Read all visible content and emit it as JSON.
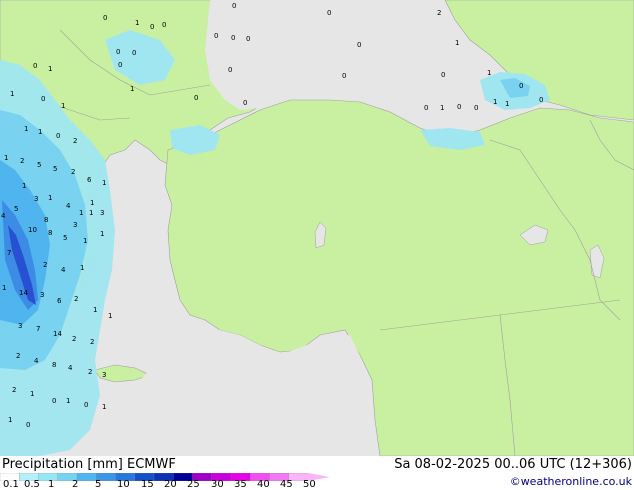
{
  "map": {
    "sea_color": "#e6e6e6",
    "land_color": "#c8f0a0",
    "border_color": "#a0a0a0",
    "precip_colors": [
      "#a0e6f0",
      "#78d2f0",
      "#50b4ee",
      "#3c8ce6",
      "#2850d2"
    ],
    "value_labels": [
      {
        "text": "0"
      },
      {
        "text": "0"
      },
      {
        "text": "1"
      },
      {
        "text": "0"
      },
      {
        "text": "0"
      },
      {
        "text": "0"
      },
      {
        "text": "2"
      },
      {
        "text": "0"
      },
      {
        "text": "1"
      },
      {
        "text": "0"
      },
      {
        "text": "0"
      },
      {
        "text": "0"
      },
      {
        "text": "0"
      },
      {
        "text": "0"
      },
      {
        "text": "0"
      },
      {
        "text": "1"
      },
      {
        "text": "0"
      },
      {
        "text": "0"
      },
      {
        "text": "1"
      },
      {
        "text": "0"
      },
      {
        "text": "0"
      },
      {
        "text": "1"
      },
      {
        "text": "0"
      },
      {
        "text": "1"
      },
      {
        "text": "1"
      },
      {
        "text": "0"
      },
      {
        "text": "0"
      },
      {
        "text": "0"
      },
      {
        "text": "1"
      },
      {
        "text": "0"
      },
      {
        "text": "0"
      },
      {
        "text": "0"
      },
      {
        "text": "1"
      },
      {
        "text": "1"
      },
      {
        "text": "0"
      },
      {
        "text": "1"
      },
      {
        "text": "0"
      },
      {
        "text": "2"
      },
      {
        "text": "1"
      },
      {
        "text": "2"
      },
      {
        "text": "5"
      },
      {
        "text": "1"
      },
      {
        "text": "1"
      },
      {
        "text": "5"
      },
      {
        "text": "2"
      },
      {
        "text": "6"
      },
      {
        "text": "1"
      },
      {
        "text": "1"
      },
      {
        "text": "3"
      },
      {
        "text": "4"
      },
      {
        "text": "1"
      },
      {
        "text": "5"
      },
      {
        "text": "4"
      },
      {
        "text": "3"
      },
      {
        "text": "1"
      },
      {
        "text": "1"
      },
      {
        "text": "3"
      },
      {
        "text": "8"
      },
      {
        "text": "10"
      },
      {
        "text": "8"
      },
      {
        "text": "5"
      },
      {
        "text": "1"
      },
      {
        "text": "1"
      },
      {
        "text": "7"
      },
      {
        "text": "2"
      },
      {
        "text": "4"
      },
      {
        "text": "1"
      },
      {
        "text": "1"
      },
      {
        "text": "14"
      },
      {
        "text": "3"
      },
      {
        "text": "6"
      },
      {
        "text": "2"
      },
      {
        "text": "1"
      },
      {
        "text": "1"
      },
      {
        "text": "3"
      },
      {
        "text": "7"
      },
      {
        "text": "14"
      },
      {
        "text": "2"
      },
      {
        "text": "2"
      },
      {
        "text": "2"
      },
      {
        "text": "4"
      },
      {
        "text": "8"
      },
      {
        "text": "4"
      },
      {
        "text": "2"
      },
      {
        "text": "3"
      },
      {
        "text": "2"
      },
      {
        "text": "1"
      },
      {
        "text": "0"
      },
      {
        "text": "1"
      },
      {
        "text": "0"
      },
      {
        "text": "1"
      },
      {
        "text": "0"
      },
      {
        "text": "1"
      }
    ]
  },
  "footer": {
    "title": "Precipitation [mm]  ECMWF",
    "datetime": "Sa 08-02-2025 00..06 UTC (12+306)",
    "credit": "©weatheronline.co.uk"
  },
  "legend": {
    "colors": [
      "#ffffff",
      "#b4f0fa",
      "#96e6f5",
      "#78d2f0",
      "#50b4ee",
      "#3c96e6",
      "#2878dc",
      "#1450c8",
      "#0a32b4",
      "#000096",
      "#a000c8",
      "#c800dc",
      "#e600e6",
      "#f050f0",
      "#f078f0",
      "#fab4fa"
    ],
    "ticks": [
      "0.1",
      "0.5",
      "1",
      "2",
      "5",
      "10",
      "15",
      "20",
      "25",
      "30",
      "35",
      "40",
      "45",
      "50"
    ]
  }
}
